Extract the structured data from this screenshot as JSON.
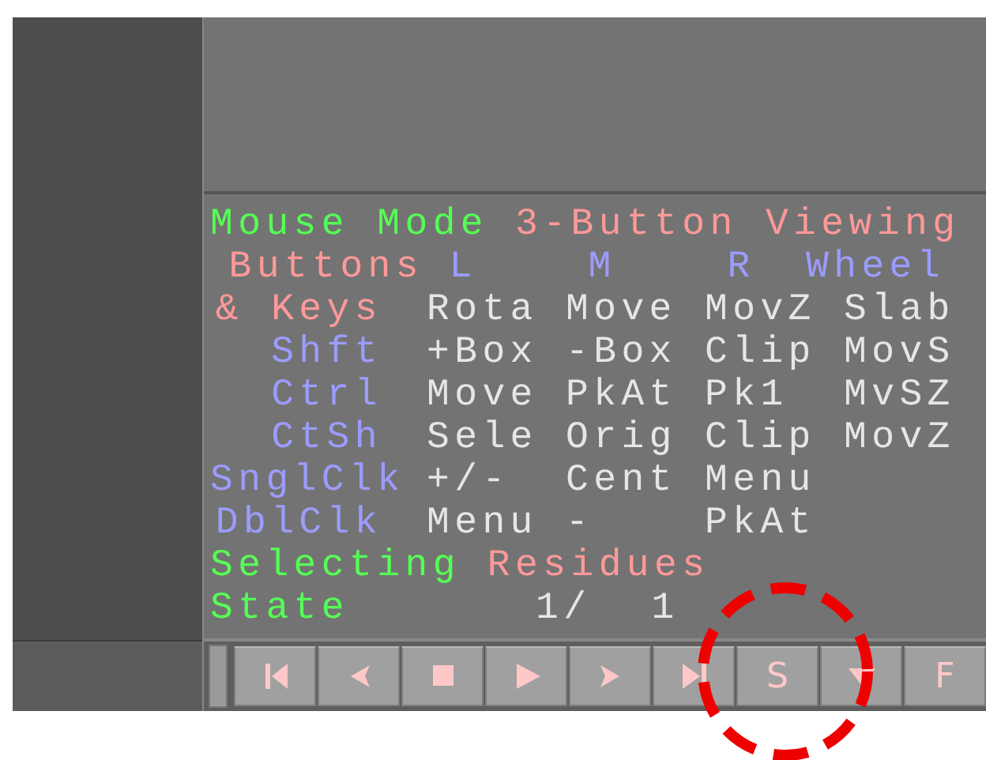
{
  "mouse_mode": {
    "label": "Mouse Mode",
    "value": "3-Button Viewing"
  },
  "button_table": {
    "label": "Buttons",
    "columns": [
      "L",
      "M",
      "R",
      "Wheel"
    ],
    "rows": [
      {
        "key": "& Keys",
        "kind": "keys",
        "values": [
          "Rota",
          "Move",
          "MovZ",
          "Slab"
        ]
      },
      {
        "key": "Shft",
        "kind": "modifier",
        "values": [
          "+Box",
          "-Box",
          "Clip",
          "MovS"
        ]
      },
      {
        "key": "Ctrl",
        "kind": "modifier",
        "values": [
          "Move",
          "PkAt",
          "Pk1",
          "MvSZ"
        ]
      },
      {
        "key": "CtSh",
        "kind": "modifier",
        "values": [
          "Sele",
          "Orig",
          "Clip",
          "MovZ"
        ]
      },
      {
        "key": "SnglClk",
        "kind": "modifier",
        "values": [
          "+/-",
          "Cent",
          "Menu"
        ]
      },
      {
        "key": "DblClk",
        "kind": "modifier",
        "values": [
          "Menu",
          "-",
          "PkAt"
        ]
      }
    ]
  },
  "selecting": {
    "label": "Selecting",
    "value": "Residues"
  },
  "state": {
    "label": "State",
    "current": "1/",
    "total": "1"
  },
  "buttons": [
    {
      "kind": "first"
    },
    {
      "kind": "prev"
    },
    {
      "kind": "stop"
    },
    {
      "kind": "play"
    },
    {
      "kind": "next"
    },
    {
      "kind": "last"
    },
    {
      "kind": "text",
      "label": "S"
    },
    {
      "kind": "down"
    },
    {
      "kind": "text",
      "label": "F"
    }
  ]
}
